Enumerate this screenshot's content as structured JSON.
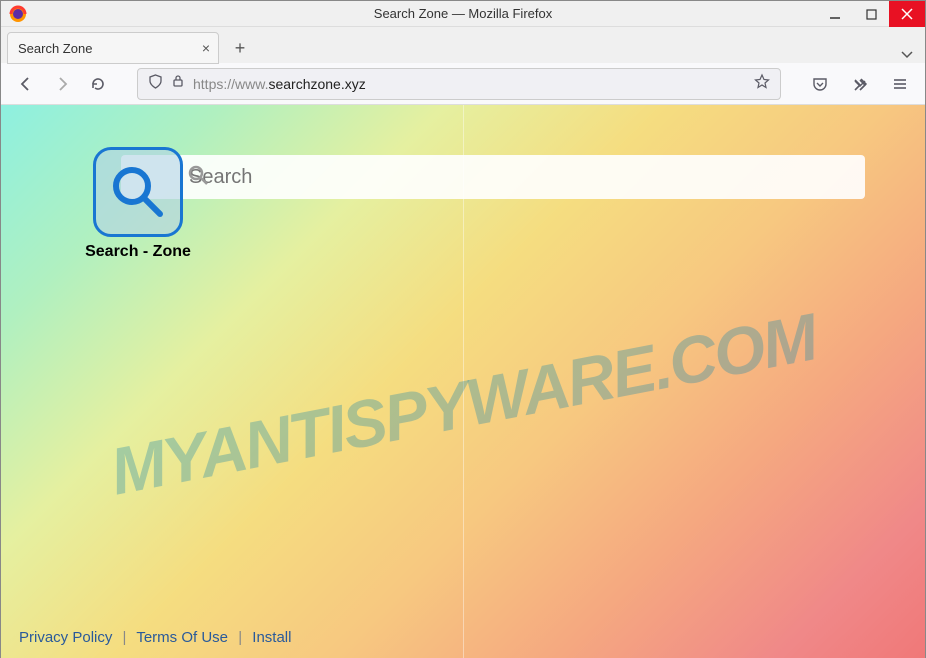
{
  "window": {
    "title": "Search Zone — Mozilla Firefox"
  },
  "tabs": {
    "active_label": "Search Zone"
  },
  "urlbar": {
    "protocol": "https://www.",
    "domain": "searchzone.xyz",
    "path": ""
  },
  "page": {
    "logo_label": "Search - Zone",
    "search_placeholder": "Search",
    "watermark": "MYANTISPYWARE.COM",
    "footer": {
      "privacy": "Privacy Policy",
      "terms": "Terms Of Use",
      "install": "Install"
    }
  }
}
